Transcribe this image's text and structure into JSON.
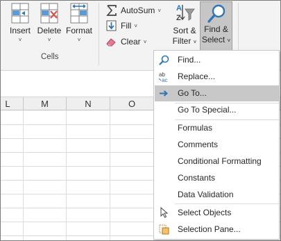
{
  "ribbon": {
    "cells_group": {
      "label": "Cells",
      "insert": {
        "label": "Insert",
        "arrow": "˅"
      },
      "delete": {
        "label": "Delete",
        "arrow": "˅"
      },
      "format": {
        "label": "Format",
        "arrow": "˅"
      }
    },
    "editing_group": {
      "autosum": {
        "label": "AutoSum",
        "arrow": "˅"
      },
      "fill": {
        "label": "Fill",
        "arrow": "˅"
      },
      "clear": {
        "label": "Clear",
        "arrow": "˅"
      },
      "sort_filter": {
        "line1": "Sort &",
        "line2": "Filter",
        "arrow": "˅"
      },
      "find_select": {
        "line1": "Find &",
        "line2": "Select",
        "arrow": "˅"
      }
    }
  },
  "sheet": {
    "columns": [
      "L",
      "M",
      "N",
      "O"
    ]
  },
  "menu": {
    "items": [
      {
        "label": "Find...",
        "icon": "magnifier-icon"
      },
      {
        "label": "Replace...",
        "icon": "replace-icon"
      },
      {
        "label": "Go To...",
        "icon": "arrow-right-icon",
        "highlighted": true
      },
      {
        "label": "Go To Special...",
        "icon": ""
      },
      {
        "label": "Formulas",
        "icon": ""
      },
      {
        "label": "Comments",
        "icon": ""
      },
      {
        "label": "Conditional Formatting",
        "icon": ""
      },
      {
        "label": "Constants",
        "icon": ""
      },
      {
        "label": "Data Validation",
        "icon": ""
      },
      {
        "label": "Select Objects",
        "icon": "pointer-icon"
      },
      {
        "label": "Selection Pane...",
        "icon": "selection-pane-icon"
      }
    ]
  },
  "colors": {
    "ribbon_bg": "#f3f3f3",
    "highlight": "#c8c8c8",
    "accent_blue": "#2e75b6",
    "delete_red": "#d9534f"
  }
}
